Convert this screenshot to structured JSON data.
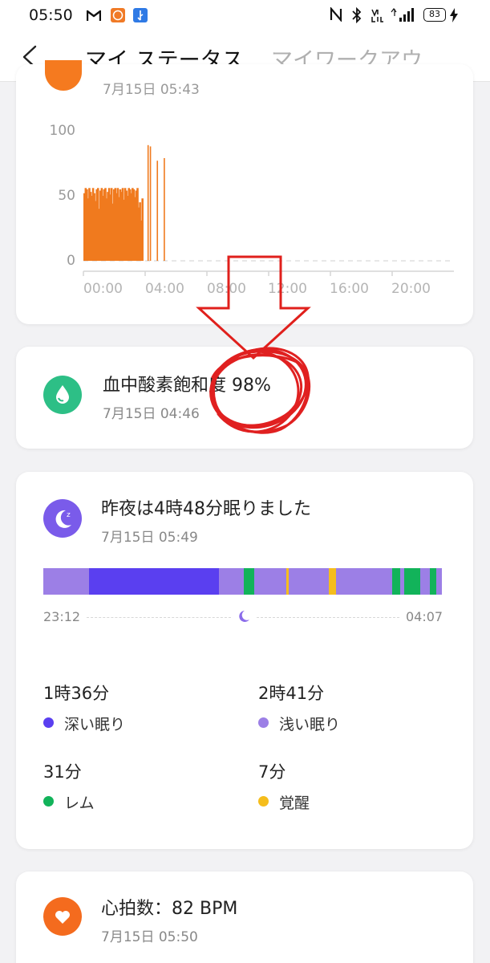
{
  "status_bar": {
    "time": "05:50",
    "battery": "83"
  },
  "header": {
    "back_label": "<",
    "tabs": [
      {
        "label": "マイ ステータス",
        "active": true
      },
      {
        "label": "マイワークアウ",
        "active": false
      }
    ]
  },
  "chart_card": {
    "partial_date": "7月15日 05:43"
  },
  "chart_data": {
    "type": "bar",
    "y_ticks": [
      "100",
      "50",
      "0"
    ],
    "x_ticks": [
      "00:00",
      "04:00",
      "08:00",
      "12:00",
      "16:00",
      "20:00"
    ],
    "ylim": [
      0,
      100
    ],
    "xlim": [
      0,
      24
    ],
    "bar_color": "#f07a1e",
    "bars": [
      {
        "t": 0.0,
        "v": 52
      },
      {
        "t": 0.08,
        "v": 56
      },
      {
        "t": 0.16,
        "v": 55
      },
      {
        "t": 0.24,
        "v": 48
      },
      {
        "t": 0.32,
        "v": 56
      },
      {
        "t": 0.4,
        "v": 53
      },
      {
        "t": 0.48,
        "v": 50
      },
      {
        "t": 0.56,
        "v": 56
      },
      {
        "t": 0.64,
        "v": 52
      },
      {
        "t": 0.72,
        "v": 46
      },
      {
        "t": 0.8,
        "v": 55
      },
      {
        "t": 0.88,
        "v": 56
      },
      {
        "t": 0.96,
        "v": 40
      },
      {
        "t": 1.04,
        "v": 54
      },
      {
        "t": 1.12,
        "v": 56
      },
      {
        "t": 1.2,
        "v": 50
      },
      {
        "t": 1.28,
        "v": 55
      },
      {
        "t": 1.36,
        "v": 56
      },
      {
        "t": 1.44,
        "v": 48
      },
      {
        "t": 1.52,
        "v": 53
      },
      {
        "t": 1.6,
        "v": 56
      },
      {
        "t": 1.68,
        "v": 51
      },
      {
        "t": 1.76,
        "v": 56
      },
      {
        "t": 1.84,
        "v": 44
      },
      {
        "t": 1.92,
        "v": 55
      },
      {
        "t": 2.0,
        "v": 56
      },
      {
        "t": 2.08,
        "v": 52
      },
      {
        "t": 2.16,
        "v": 56
      },
      {
        "t": 2.24,
        "v": 49
      },
      {
        "t": 2.32,
        "v": 55
      },
      {
        "t": 2.4,
        "v": 53
      },
      {
        "t": 2.48,
        "v": 56
      },
      {
        "t": 2.56,
        "v": 47
      },
      {
        "t": 2.64,
        "v": 56
      },
      {
        "t": 2.72,
        "v": 54
      },
      {
        "t": 2.8,
        "v": 50
      },
      {
        "t": 2.88,
        "v": 56
      },
      {
        "t": 2.96,
        "v": 55
      },
      {
        "t": 3.04,
        "v": 52
      },
      {
        "t": 3.12,
        "v": 56
      },
      {
        "t": 3.2,
        "v": 55
      },
      {
        "t": 3.28,
        "v": 49
      },
      {
        "t": 3.36,
        "v": 54
      },
      {
        "t": 3.44,
        "v": 56
      },
      {
        "t": 3.52,
        "v": 41
      },
      {
        "t": 3.6,
        "v": 45
      },
      {
        "t": 3.68,
        "v": 31
      },
      {
        "t": 3.76,
        "v": 48
      },
      {
        "t": 4.15,
        "v": 89
      },
      {
        "t": 4.3,
        "v": 88
      },
      {
        "t": 4.75,
        "v": 77
      },
      {
        "t": 5.2,
        "v": 79
      }
    ]
  },
  "oxygen": {
    "title": "血中酸素飽和度 98%",
    "date": "7月15日 04:46",
    "icon": "water-drop-icon",
    "accent": "#2dbf86"
  },
  "sleep": {
    "title": "昨夜は4時48分眠りました",
    "date": "7月15日 05:49",
    "icon": "moon-icon",
    "start": "23:12",
    "end": "04:07",
    "colors": {
      "deep": "#5a3ff0",
      "light": "#9c7fe6",
      "rem": "#12b35a",
      "awake": "#f5bd1c"
    },
    "segments": [
      {
        "type": "light",
        "start": 0.0,
        "end": 0.115
      },
      {
        "type": "deep",
        "start": 0.115,
        "end": 0.44
      },
      {
        "type": "light",
        "start": 0.44,
        "end": 0.503
      },
      {
        "type": "rem",
        "start": 0.503,
        "end": 0.53
      },
      {
        "type": "light",
        "start": 0.53,
        "end": 0.61
      },
      {
        "type": "awake",
        "start": 0.61,
        "end": 0.616
      },
      {
        "type": "light",
        "start": 0.616,
        "end": 0.716
      },
      {
        "type": "awake",
        "start": 0.716,
        "end": 0.734
      },
      {
        "type": "light",
        "start": 0.734,
        "end": 0.875
      },
      {
        "type": "rem",
        "start": 0.875,
        "end": 0.895
      },
      {
        "type": "light",
        "start": 0.895,
        "end": 0.905
      },
      {
        "type": "rem",
        "start": 0.905,
        "end": 0.945
      },
      {
        "type": "light",
        "start": 0.945,
        "end": 0.97
      },
      {
        "type": "rem",
        "start": 0.97,
        "end": 0.985
      },
      {
        "type": "light",
        "start": 0.985,
        "end": 1.0
      }
    ],
    "stats": [
      {
        "value": "1時36分",
        "label": "深い眠り",
        "type": "deep"
      },
      {
        "value": "2時41分",
        "label": "浅い眠り",
        "type": "light"
      },
      {
        "value": "31分",
        "label": "レム",
        "type": "rem"
      },
      {
        "value": "7分",
        "label": "覚醒",
        "type": "awake"
      }
    ]
  },
  "heart": {
    "title": "心拍数：82 BPM",
    "date": "7月15日 05:50",
    "icon": "heart-icon",
    "accent": "#f46b1e"
  }
}
